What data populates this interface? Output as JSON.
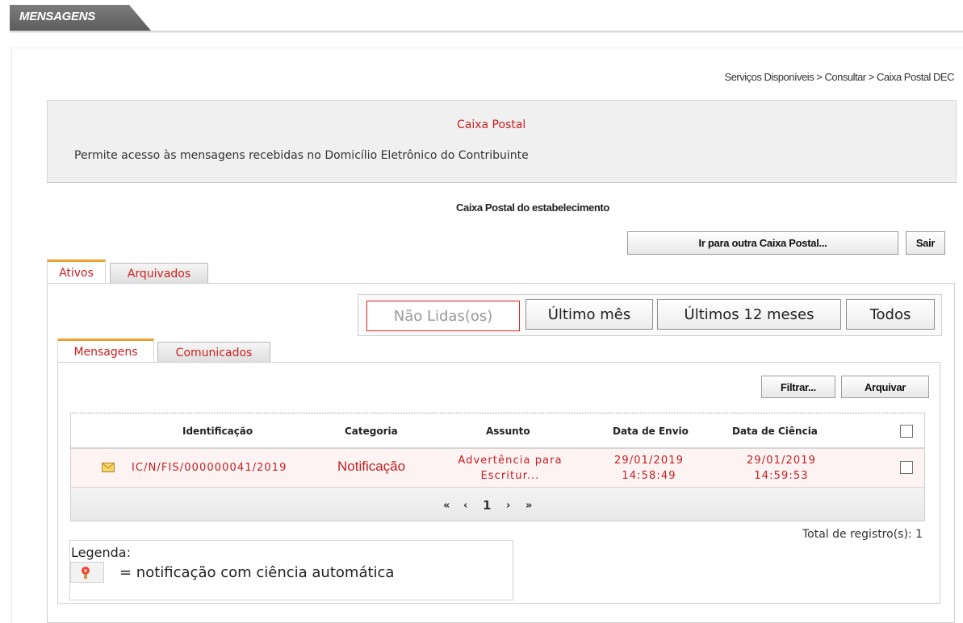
{
  "header": {
    "tab_label": "MENSAGENS"
  },
  "breadcrumb": "Serviços Disponíveis > Consultar > Caixa Postal DEC",
  "info": {
    "title": "Caixa Postal",
    "description": "Permite acesso às mensagens recebidas no Domicílio Eletrônico do Contribuinte"
  },
  "section_title": "Caixa Postal do estabelecimento",
  "actions": {
    "other_mailbox": "Ir para outra Caixa Postal...",
    "exit": "Sair"
  },
  "outer_tabs": [
    {
      "label": "Ativos",
      "active": true
    },
    {
      "label": "Arquivados",
      "active": false
    }
  ],
  "filters": [
    "Não Lidas(os)",
    "Último mês",
    "Últimos 12 meses",
    "Todos"
  ],
  "inner_tabs": [
    {
      "label": "Mensagens",
      "active": true
    },
    {
      "label": "Comunicados",
      "active": false
    }
  ],
  "toolbar": {
    "filter": "Filtrar...",
    "archive": "Arquivar"
  },
  "table": {
    "columns": [
      "Identificação",
      "Categoria",
      "Assunto",
      "Data de Envio",
      "Data de Ciência"
    ],
    "rows": [
      {
        "identification": "IC/N/FIS/000000041/2019",
        "category": "Notificação",
        "subject_line1": "Advertência para",
        "subject_line2": "Escritur...",
        "sent_date": "29/01/2019",
        "sent_time": "14:58:49",
        "ack_date": "29/01/2019",
        "ack_time": "14:59:53"
      }
    ]
  },
  "pager": {
    "first": "«",
    "prev": "‹",
    "page": "1",
    "next": "›",
    "last": "»"
  },
  "total": "Total de registro(s): 1",
  "legend": {
    "title": "Legenda:",
    "text": "= notificação com ciência automática"
  },
  "colors": {
    "accent_red": "#cc1f1f",
    "tab_orange": "#f0a030",
    "row_bg": "#fdf3f3"
  }
}
